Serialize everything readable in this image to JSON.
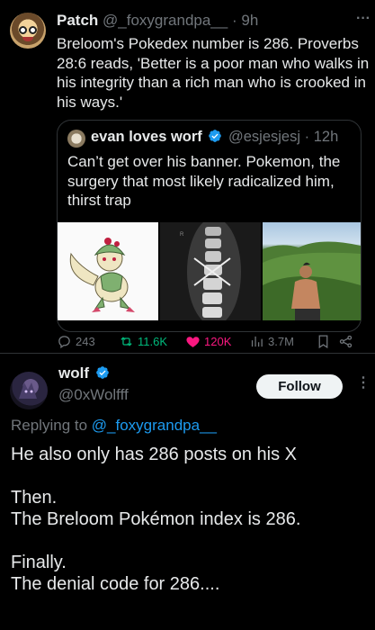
{
  "post": {
    "author_name": "Patch",
    "author_handle": "@_foxygrandpa__",
    "separator": "·",
    "time": "9h",
    "text": "Breloom's Pokedex number is 286. Proverbs 28:6 reads, 'Better is a poor man who walks in his integrity than a rich man who is crooked in his ways.'",
    "more_icon": "···"
  },
  "quote": {
    "author_name": "evan loves worf",
    "author_handle": "@esjesjesj",
    "separator": "·",
    "time": "12h",
    "text": "Can’t get over his banner. Pokemon, the surgery that most likely radicalized him, thirst trap"
  },
  "actions": {
    "replies": "243",
    "reposts": "11.6K",
    "likes": "120K",
    "views": "3.7M"
  },
  "reply": {
    "author_name": "wolf",
    "author_handle": "@0xWolfff",
    "follow_label": "Follow",
    "replying_to_label": "Replying to",
    "replying_to_handle": "@_foxygrandpa__",
    "text": "He also only has 286 posts on his X\n\nThen.\nThe Breloom Pokémon index is 286.\n\nFinally.\nThe denial code for  286....",
    "more_icon": "⋮"
  },
  "colors": {
    "background": "#000000",
    "text": "#e7e9ea",
    "muted": "#71767b",
    "accent": "#1d9bf0",
    "like": "#f91880",
    "border": "#2f3336"
  }
}
